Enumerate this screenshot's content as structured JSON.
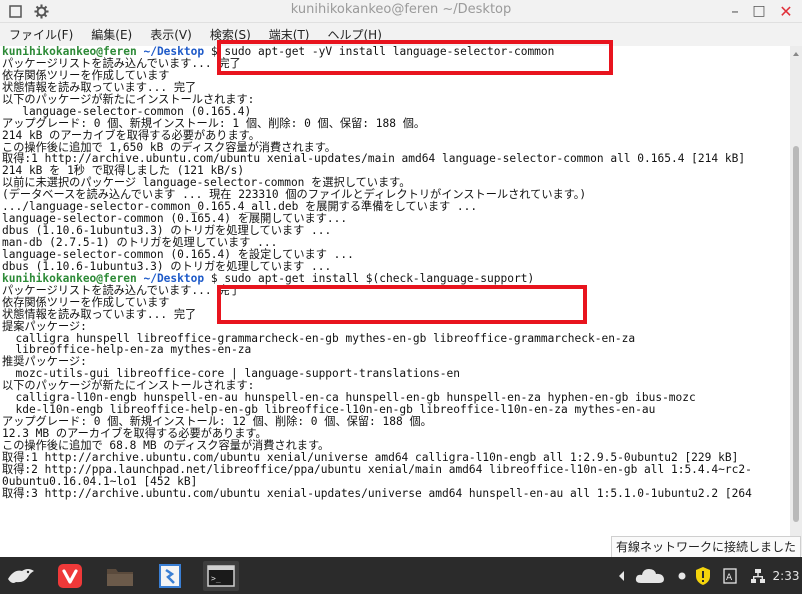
{
  "window": {
    "title": "kunihikokankeo@feren ~/Desktop",
    "minimize": "–",
    "maximize": "□",
    "close": "✕"
  },
  "menu": [
    "ファイル(F)",
    "編集(E)",
    "表示(V)",
    "検索(S)",
    "端末(T)",
    "ヘルプ(H)"
  ],
  "prompt": {
    "user": "kunihikokankeo@feren",
    "path": "~/Desktop",
    "symbol": "$"
  },
  "commands": [
    "sudo apt-get -yV install language-selector-common",
    "sudo apt-get install $(check-language-support)"
  ],
  "terminal_lines": [
    {
      "prompt": true,
      "cmd": 0
    },
    {
      "text": "パッケージリストを読み込んでいます... 完了"
    },
    {
      "text": "依存関係ツリーを作成しています"
    },
    {
      "text": "状態情報を読み取っています... 完了"
    },
    {
      "text": "以下のパッケージが新たにインストールされます:"
    },
    {
      "text": "   language-selector-common (0.165.4)"
    },
    {
      "text": "アップグレード: 0 個、新規インストール: 1 個、削除: 0 個、保留: 188 個。"
    },
    {
      "text": "214 kB のアーカイブを取得する必要があります。"
    },
    {
      "text": "この操作後に追加で 1,650 kB のディスク容量が消費されます。"
    },
    {
      "text": "取得:1 http://archive.ubuntu.com/ubuntu xenial-updates/main amd64 language-selector-common all 0.165.4 [214 kB]"
    },
    {
      "text": "214 kB を 1秒 で取得しました (121 kB/s)"
    },
    {
      "text": "以前に未選択のパッケージ language-selector-common を選択しています。"
    },
    {
      "text": "(データベースを読み込んでいます ... 現在 223310 個のファイルとディレクトリがインストールされています。)"
    },
    {
      "text": ".../language-selector-common_0.165.4_all.deb を展開する準備をしています ..."
    },
    {
      "text": "language-selector-common (0.165.4) を展開しています..."
    },
    {
      "text": "dbus (1.10.6-1ubuntu3.3) のトリガを処理しています ..."
    },
    {
      "text": "man-db (2.7.5-1) のトリガを処理しています ..."
    },
    {
      "text": "language-selector-common (0.165.4) を設定しています ..."
    },
    {
      "text": "dbus (1.10.6-1ubuntu3.3) のトリガを処理しています ..."
    },
    {
      "prompt": true,
      "cmd": 1
    },
    {
      "text": "パッケージリストを読み込んでいます... 完了"
    },
    {
      "text": "依存関係ツリーを作成しています"
    },
    {
      "text": "状態情報を読み取っています... 完了"
    },
    {
      "text": "提案パッケージ:"
    },
    {
      "text": "  calligra hunspell libreoffice-grammarcheck-en-gb mythes-en-gb libreoffice-grammarcheck-en-za"
    },
    {
      "text": "  libreoffice-help-en-za mythes-en-za"
    },
    {
      "text": "推奨パッケージ:"
    },
    {
      "text": "  mozc-utils-gui libreoffice-core | language-support-translations-en"
    },
    {
      "text": "以下のパッケージが新たにインストールされます:"
    },
    {
      "text": "  calligra-l10n-engb hunspell-en-au hunspell-en-ca hunspell-en-gb hunspell-en-za hyphen-en-gb ibus-mozc"
    },
    {
      "text": "  kde-l10n-engb libreoffice-help-en-gb libreoffice-l10n-en-gb libreoffice-l10n-en-za mythes-en-au"
    },
    {
      "text": "アップグレード: 0 個、新規インストール: 12 個、削除: 0 個、保留: 188 個。"
    },
    {
      "text": "12.3 MB のアーカイブを取得する必要があります。"
    },
    {
      "text": "この操作後に追加で 68.8 MB のディスク容量が消費されます。"
    },
    {
      "text": "取得:1 http://archive.ubuntu.com/ubuntu xenial/universe amd64 calligra-l10n-engb all 1:2.9.5-0ubuntu2 [229 kB]"
    },
    {
      "text": "取得:2 http://ppa.launchpad.net/libreoffice/ppa/ubuntu xenial/main amd64 libreoffice-l10n-en-gb all 1:5.4.4~rc2-"
    },
    {
      "text": "0ubuntu0.16.04.1~lo1 [452 kB]"
    },
    {
      "text": "取得:3 http://archive.ubuntu.com/ubuntu xenial-updates/universe amd64 hunspell-en-au all 1:5.1.0-1ubuntu2.2 [264"
    }
  ],
  "notification": "有線ネットワークに接続しました",
  "taskbar": {
    "apps": [
      "feren-logo-icon",
      "vivaldi-icon",
      "file-manager-icon",
      "software-center-icon",
      "terminal-icon"
    ],
    "tray_clock": "2:33",
    "colors": {
      "taskbar": "#2b2b2b",
      "vivaldi": "#ef3939",
      "folder": "#6b5a4a",
      "shield": "#f4d40c"
    }
  }
}
